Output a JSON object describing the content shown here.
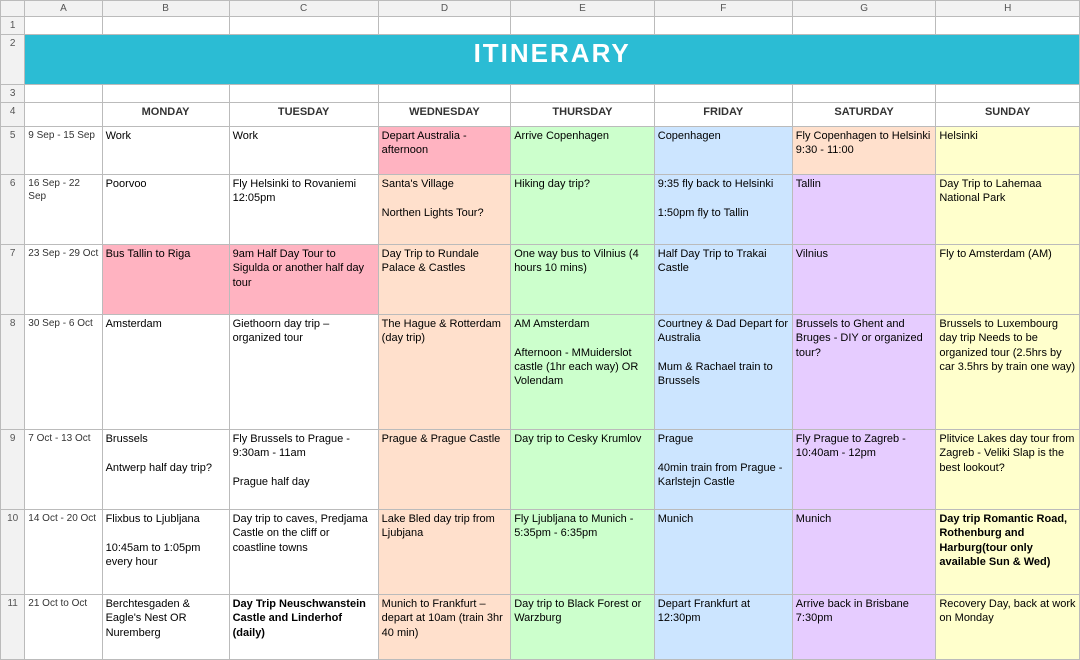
{
  "title": "ITINERARY",
  "col_headers": [
    "",
    "A",
    "B",
    "C",
    "D",
    "E",
    "F",
    "G",
    "H"
  ],
  "day_headers": [
    "MONDAY",
    "TUESDAY",
    "WEDNESDAY",
    "THURSDAY",
    "FRIDAY",
    "SATURDAY",
    "SUNDAY"
  ],
  "rows": [
    {
      "row_num": "1",
      "week": "",
      "cells": [
        "",
        "",
        "",
        "",
        "",
        "",
        "",
        ""
      ]
    },
    {
      "row_num": "2",
      "week": "",
      "cells": [
        "ITINERARY",
        "",
        "",
        "",
        "",
        "",
        "",
        ""
      ]
    },
    {
      "row_num": "3",
      "week": "",
      "cells": [
        "",
        "",
        "",
        "",
        "",
        "",
        "",
        ""
      ]
    },
    {
      "row_num": "4",
      "week": "",
      "cells": [
        "MONDAY",
        "TUESDAY",
        "WEDNESDAY",
        "THURSDAY",
        "FRIDAY",
        "SATURDAY",
        "SUNDAY"
      ]
    },
    {
      "row_num": "5",
      "week": "9 Sep - 15 Sep",
      "cells": [
        {
          "text": "Work",
          "color": "white"
        },
        {
          "text": "Work",
          "color": "white"
        },
        {
          "text": "Depart Australia - afternoon",
          "color": "pink"
        },
        {
          "text": "Arrive Copenhagen",
          "color": "green"
        },
        {
          "text": "Copenhagen",
          "color": "blue"
        },
        {
          "text": "Fly Copenhagen to Helsinki 9:30 - 11:00",
          "color": "peach"
        },
        {
          "text": "Helsinki",
          "color": "yellow"
        }
      ]
    },
    {
      "row_num": "6",
      "week": "16 Sep - 22 Sep",
      "cells": [
        {
          "text": "Poorvoo",
          "color": "white"
        },
        {
          "text": "Fly Helsinki to Rovaniemi 12:05pm",
          "color": "white"
        },
        {
          "text": "Santa's Village\n\nNorthen Lights Tour?",
          "color": "peach"
        },
        {
          "text": "Hiking day trip?",
          "color": "green"
        },
        {
          "text": "9:35 fly back to Helsinki\n\n1:50pm fly to Tallin",
          "color": "blue"
        },
        {
          "text": "Tallin",
          "color": "lavender"
        },
        {
          "text": "Day Trip to Lahemaa National Park",
          "color": "yellow"
        }
      ]
    },
    {
      "row_num": "7",
      "week": "23 Sep - 29 Oct",
      "cells": [
        {
          "text": "Bus Tallin to Riga",
          "color": "pink"
        },
        {
          "text": "9am Half Day Tour to Sigulda or another half day tour",
          "color": "pink"
        },
        {
          "text": "Day Trip to Rundale Palace & Castles",
          "color": "peach"
        },
        {
          "text": "One way bus to Vilnius (4 hours 10 mins)",
          "color": "green"
        },
        {
          "text": "Half Day Trip to Trakai Castle",
          "color": "blue"
        },
        {
          "text": "Vilnius",
          "color": "lavender"
        },
        {
          "text": "Fly to Amsterdam (AM)",
          "color": "yellow"
        }
      ]
    },
    {
      "row_num": "8",
      "week": "30 Sep - 6 Oct",
      "cells": [
        {
          "text": "Amsterdam",
          "color": "white"
        },
        {
          "text": "Giethoorn day trip – organized tour",
          "color": "white"
        },
        {
          "text": "The Hague & Rotterdam (day trip)",
          "color": "peach"
        },
        {
          "text": "AM Amsterdam\n\nAfternoon - MMuiderslot castle (1hr each way) OR Volendam",
          "color": "green"
        },
        {
          "text": "Courtney & Dad Depart for Australia\n\nMum & Rachael train to Brussels",
          "color": "blue"
        },
        {
          "text": "Brussels to Ghent and Bruges - DIY or organized tour?",
          "color": "lavender"
        },
        {
          "text": "Brussels to Luxembourg day trip Needs to be organized tour (2.5hrs by car 3.5hrs by train one way)",
          "color": "yellow"
        }
      ]
    },
    {
      "row_num": "9",
      "week": "7 Oct - 13 Oct",
      "cells": [
        {
          "text": "Brussels\n\nAntwerp half day trip?",
          "color": "white"
        },
        {
          "text": "Fly Brussels to Prague - 9:30am - 11am\n\nPrague half day",
          "color": "white"
        },
        {
          "text": "Prague & Prague Castle",
          "color": "peach"
        },
        {
          "text": "Day trip to Cesky Krumlov",
          "color": "green"
        },
        {
          "text": "Prague\n\n40min train from Prague - Karlstejn Castle",
          "color": "blue"
        },
        {
          "text": "Fly Prague to Zagreb - 10:40am - 12pm",
          "color": "lavender"
        },
        {
          "text": "Plitvice Lakes day tour from Zagreb - Veliki Slap is the best lookout?",
          "color": "yellow"
        }
      ]
    },
    {
      "row_num": "10",
      "week": "14 Oct - 20 Oct",
      "cells": [
        {
          "text": "Flixbus to Ljubljana\n\n10:45am to 1:05pm every hour",
          "color": "white"
        },
        {
          "text": "Day trip to caves, Predjama Castle on the cliff or coastline towns",
          "color": "white"
        },
        {
          "text": "Lake Bled day trip from Ljubjana",
          "color": "peach"
        },
        {
          "text": "Fly Ljubljana to Munich - 5:35pm - 6:35pm",
          "color": "green"
        },
        {
          "text": "Munich",
          "color": "blue"
        },
        {
          "text": "Munich",
          "color": "lavender"
        },
        {
          "text": "Day trip Romantic Road, Rothenburg and Harburg(tour only available Sun & Wed)",
          "color": "yellow",
          "bold": true
        }
      ]
    },
    {
      "row_num": "11",
      "week": "21 Oct to Oct",
      "cells": [
        {
          "text": "Berchtesgaden & Eagle's Nest OR Nuremberg",
          "color": "white"
        },
        {
          "text": "Day Trip Neuschwanstein Castle and Linderhof (daily)",
          "color": "white",
          "bold": true
        },
        {
          "text": "Munich to Frankfurt – depart at 10am (train 3hr 40 min)",
          "color": "peach"
        },
        {
          "text": "Day trip to Black Forest or Warzburg",
          "color": "green"
        },
        {
          "text": "Depart Frankfurt at 12:30pm",
          "color": "blue"
        },
        {
          "text": "Arrive back in Brisbane 7:30pm",
          "color": "lavender"
        },
        {
          "text": "Recovery Day, back at work on Monday",
          "color": "yellow"
        }
      ]
    }
  ]
}
